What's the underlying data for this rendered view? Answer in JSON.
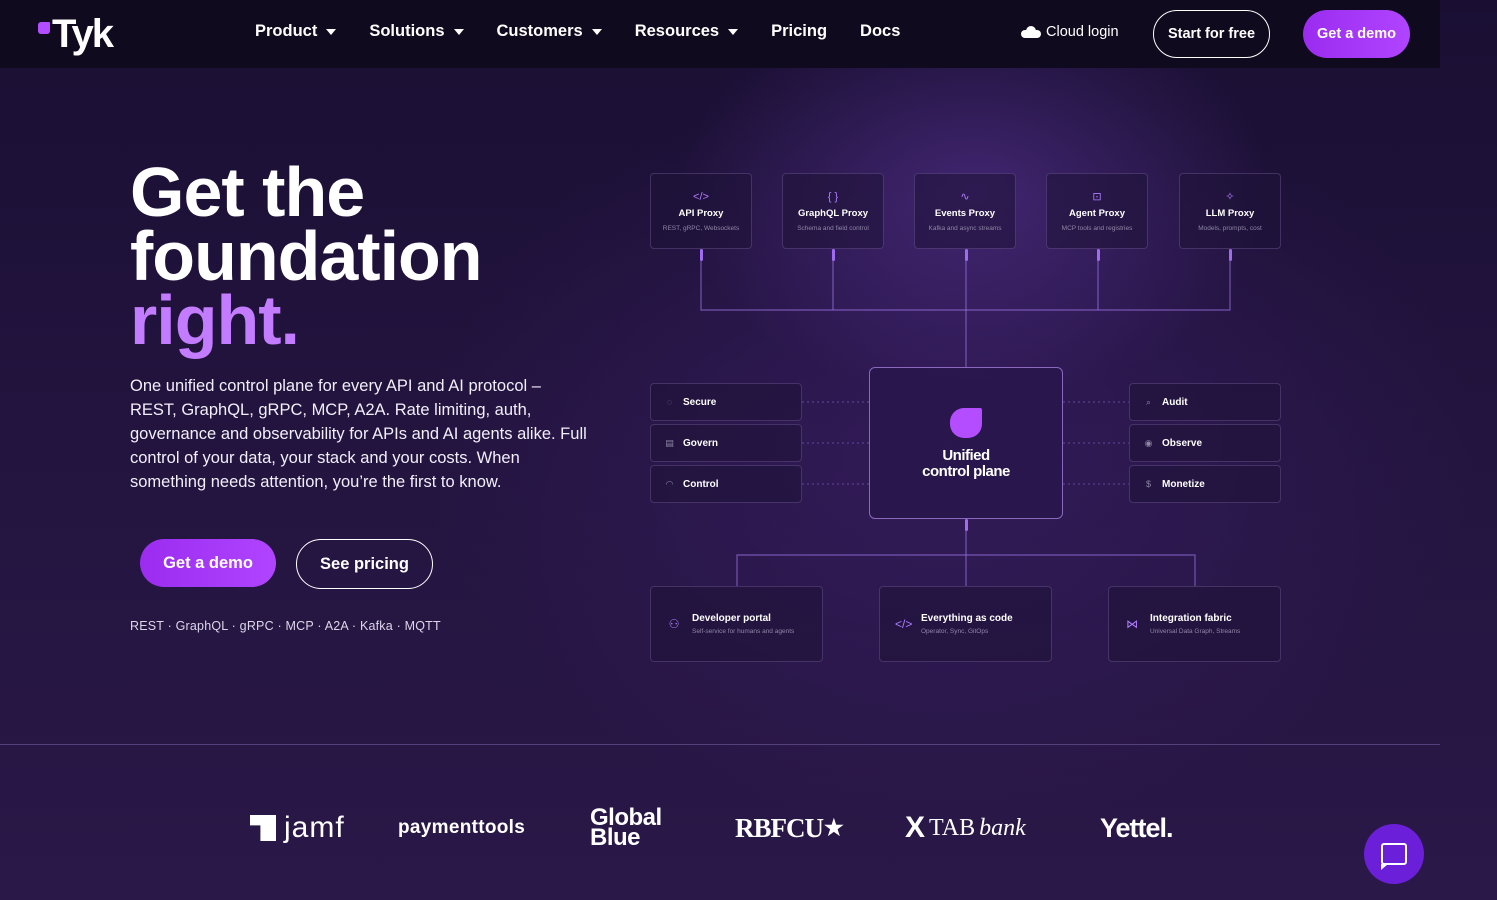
{
  "nav": {
    "logo": "Tyk",
    "menu": [
      {
        "label": "Product",
        "dropdown": true
      },
      {
        "label": "Solutions",
        "dropdown": true
      },
      {
        "label": "Customers",
        "dropdown": true
      },
      {
        "label": "Resources",
        "dropdown": true
      },
      {
        "label": "Pricing",
        "dropdown": false
      },
      {
        "label": "Docs",
        "dropdown": false
      }
    ],
    "cloud_login": "Cloud login",
    "start_free": "Start for free",
    "get_demo": "Get a demo"
  },
  "hero": {
    "title_line1": "Get the",
    "title_line2": "foundation",
    "title_line3": "right.",
    "description": "One unified control plane for every API and AI protocol – REST, GraphQL, gRPC, MCP, A2A. Rate limiting, auth, governance and observability for APIs and AI agents alike. Full control of your data, your stack and your costs. When something needs attention, you’re the first to know.",
    "demo_button": "Get a demo",
    "pricing_button": "See pricing",
    "protocols": "REST · GraphQL · gRPC · MCP · A2A · Kafka · MQTT"
  },
  "diagram": {
    "proxies": [
      {
        "icon": "</>",
        "title": "API Proxy",
        "sub": "REST, gRPC, Websockets"
      },
      {
        "icon": "{ }",
        "title": "GraphQL Proxy",
        "sub": "Schema and field control"
      },
      {
        "icon": "∿",
        "title": "Events Proxy",
        "sub": "Kafka and async streams"
      },
      {
        "icon": "⊡",
        "title": "Agent Proxy",
        "sub": "MCP tools and registries"
      },
      {
        "icon": "✧",
        "title": "LLM Proxy",
        "sub": "Models, prompts, cost"
      }
    ],
    "left": [
      {
        "icon": "◌",
        "title": "Secure"
      },
      {
        "icon": "▤",
        "title": "Govern"
      },
      {
        "icon": "◠",
        "title": "Control"
      }
    ],
    "right": [
      {
        "icon": "⌕",
        "title": "Audit"
      },
      {
        "icon": "◉",
        "title": "Observe"
      },
      {
        "icon": "$",
        "title": "Monetize"
      }
    ],
    "center_line1": "Unified",
    "center_line2": "control plane",
    "bottom": [
      {
        "icon": "⚇",
        "title": "Developer portal",
        "sub": "Self-service for humans and agents"
      },
      {
        "icon": "</>",
        "title": "Everything as code",
        "sub": "Operator, Sync, GitOps"
      },
      {
        "icon": "⋈",
        "title": "Integration fabric",
        "sub": "Universal Data Graph, Streams"
      }
    ]
  },
  "logos": {
    "jamf": "jamf",
    "paymenttools": "paymenttools",
    "globalblue_1": "Global",
    "globalblue_2": "Blue",
    "rbfcu": "RBFCU",
    "tab_x": "X",
    "tab": "TAB",
    "tab_bank": "bank",
    "yettel": "Yettel."
  },
  "colors": {
    "accent": "#b044ff",
    "accent_text": "#c37bff",
    "nav_bg": "#0f0a1e",
    "page_bg": "#23143f"
  }
}
